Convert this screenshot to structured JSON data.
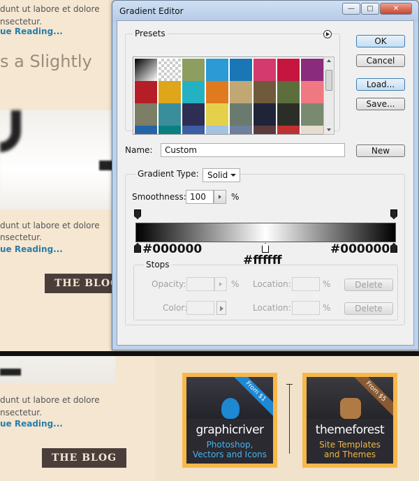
{
  "background": {
    "text_top_1": "dunt ut labore et dolore",
    "text_top_2": "nsectetur.",
    "link_top": "ue Reading...",
    "heading": "s a Slightly",
    "text_mid_1": "dunt ut labore et dolore",
    "text_mid_2": "nsectetur.",
    "link_mid": "ue Reading...",
    "blog_button_top": "THE BLOG",
    "text_bot_1": "dunt ut labore et dolore",
    "text_bot_2": "nsectetur.",
    "link_bot": "ue Reading...",
    "blog_button_bottom": "THE BLOG"
  },
  "ads": [
    {
      "ribbon": "From $1",
      "brand": "graphicriver",
      "sub_1": "Photoshop,",
      "sub_2": "Vectors and Icons",
      "accent": "#1e88d3",
      "sub_color": "#47b4f2"
    },
    {
      "ribbon": "From $5",
      "brand": "themeforest",
      "sub_1": "Site Templates",
      "sub_2": "and Themes",
      "accent": "#8a5a34",
      "sub_color": "#f1b845"
    }
  ],
  "window": {
    "title": "Gradient Editor",
    "controls": {
      "minimize": "—",
      "maximize": "□",
      "close": "✕"
    }
  },
  "presets": {
    "label": "Presets",
    "menu_icon": "circle-arrow-icon",
    "swatches": [
      [
        "linear-gradient(135deg,#000,#fff)",
        "checker",
        "#8d9e60",
        "#2b9ad5",
        "#1a76b5",
        "#d53a6e",
        "#c6163f",
        "#8b2b7d"
      ],
      [
        "#b51e27",
        "#dfa51b",
        "#24b2c3",
        "#e07a1d",
        "#c1a873",
        "#6f5a3b",
        "#5c6e3b",
        "#f07880"
      ],
      [
        "#7d7e66",
        "#3a8e9b",
        "#2e2e55",
        "#e5d04a",
        "#6b7a6e",
        "#1f2438",
        "#2b2e27",
        "#7a8a70"
      ],
      [
        "#2565a6",
        "#0b8080",
        "#3c5ea3",
        "#a3c3e3",
        "#6f7f9f",
        "#5a3b3b",
        "#c03030",
        "#e6dccf"
      ]
    ]
  },
  "buttons": {
    "ok": "OK",
    "cancel": "Cancel",
    "load": "Load...",
    "save": "Save...",
    "new": "New"
  },
  "name": {
    "label": "Name:",
    "value": "Custom"
  },
  "gradient": {
    "type_label": "Gradient Type:",
    "type_value": "Solid",
    "smoothness_label": "Smoothness:",
    "smoothness_value": "100",
    "smoothness_unit": "%",
    "stop_left": "#000000",
    "stop_mid": "#ffffff",
    "stop_right": "#000000"
  },
  "stops": {
    "label": "Stops",
    "opacity_label": "Opacity:",
    "opacity_unit": "%",
    "location_label_1": "Location:",
    "location_unit_1": "%",
    "delete_1": "Delete",
    "color_label": "Color:",
    "location_label_2": "Location:",
    "location_unit_2": "%",
    "delete_2": "Delete"
  }
}
